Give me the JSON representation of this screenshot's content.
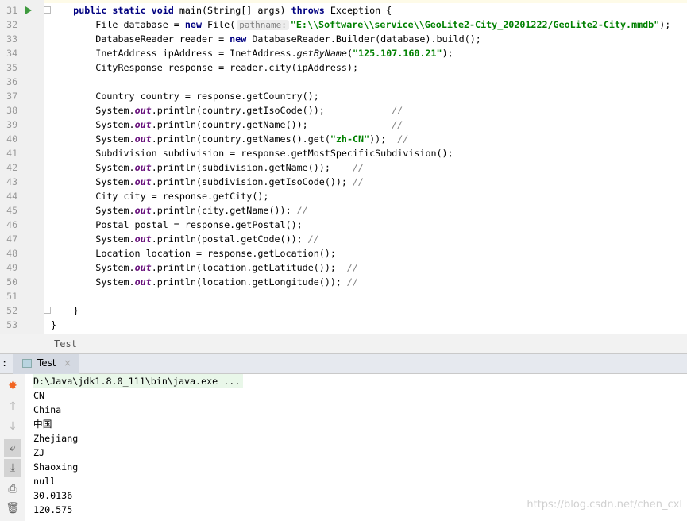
{
  "editor": {
    "lines": [
      {
        "n": "31",
        "seg": [
          [
            "t",
            "    "
          ],
          [
            "k",
            "public static void "
          ],
          [
            "t",
            "main(String[] args) "
          ],
          [
            "k",
            "throws "
          ],
          [
            "t",
            "Exception {"
          ]
        ]
      },
      {
        "n": "32",
        "seg": [
          [
            "t",
            "        File database = "
          ],
          [
            "k",
            "new "
          ],
          [
            "t",
            "File("
          ],
          [
            "h",
            "pathname:"
          ],
          [
            "s",
            "\"E:\\\\Software\\\\service\\\\GeoLite2-City_20201222/GeoLite2-City.mmdb\""
          ],
          [
            "t",
            ");"
          ]
        ]
      },
      {
        "n": "33",
        "seg": [
          [
            "t",
            "        DatabaseReader reader = "
          ],
          [
            "k",
            "new "
          ],
          [
            "t",
            "DatabaseReader.Builder(database).build();"
          ]
        ]
      },
      {
        "n": "34",
        "seg": [
          [
            "t",
            "        InetAddress ipAddress = InetAddress."
          ],
          [
            "i",
            "getByName"
          ],
          [
            "t",
            "("
          ],
          [
            "s",
            "\"125.107.160.21\""
          ],
          [
            "t",
            ");"
          ]
        ]
      },
      {
        "n": "35",
        "seg": [
          [
            "t",
            "        CityResponse response = reader.city(ipAddress);"
          ]
        ]
      },
      {
        "n": "36",
        "seg": []
      },
      {
        "n": "37",
        "seg": [
          [
            "t",
            "        Country country = response.getCountry();"
          ]
        ]
      },
      {
        "n": "38",
        "seg": [
          [
            "t",
            "        System."
          ],
          [
            "o",
            "out"
          ],
          [
            "t",
            ".println(country.getIsoCode());            "
          ],
          [
            "c",
            "//"
          ]
        ]
      },
      {
        "n": "39",
        "seg": [
          [
            "t",
            "        System."
          ],
          [
            "o",
            "out"
          ],
          [
            "t",
            ".println(country.getName());               "
          ],
          [
            "c",
            "//"
          ]
        ]
      },
      {
        "n": "40",
        "seg": [
          [
            "t",
            "        System."
          ],
          [
            "o",
            "out"
          ],
          [
            "t",
            ".println(country.getNames().get("
          ],
          [
            "s",
            "\"zh-CN\""
          ],
          [
            "t",
            "));  "
          ],
          [
            "c",
            "//"
          ]
        ]
      },
      {
        "n": "41",
        "seg": [
          [
            "t",
            "        Subdivision subdivision = response.getMostSpecificSubdivision();"
          ]
        ]
      },
      {
        "n": "42",
        "seg": [
          [
            "t",
            "        System."
          ],
          [
            "o",
            "out"
          ],
          [
            "t",
            ".println(subdivision.getName());    "
          ],
          [
            "c",
            "//"
          ]
        ]
      },
      {
        "n": "43",
        "seg": [
          [
            "t",
            "        System."
          ],
          [
            "o",
            "out"
          ],
          [
            "t",
            ".println(subdivision.getIsoCode()); "
          ],
          [
            "c",
            "//"
          ]
        ]
      },
      {
        "n": "44",
        "seg": [
          [
            "t",
            "        City city = response.getCity();"
          ]
        ]
      },
      {
        "n": "45",
        "seg": [
          [
            "t",
            "        System."
          ],
          [
            "o",
            "out"
          ],
          [
            "t",
            ".println(city.getName()); "
          ],
          [
            "c",
            "//"
          ]
        ]
      },
      {
        "n": "46",
        "seg": [
          [
            "t",
            "        Postal postal = response.getPostal();"
          ]
        ]
      },
      {
        "n": "47",
        "seg": [
          [
            "t",
            "        System."
          ],
          [
            "o",
            "out"
          ],
          [
            "t",
            ".println(postal.getCode()); "
          ],
          [
            "c",
            "//"
          ]
        ]
      },
      {
        "n": "48",
        "seg": [
          [
            "t",
            "        Location location = response.getLocation();"
          ]
        ]
      },
      {
        "n": "49",
        "seg": [
          [
            "t",
            "        System."
          ],
          [
            "o",
            "out"
          ],
          [
            "t",
            ".println(location.getLatitude());  "
          ],
          [
            "c",
            "//"
          ]
        ]
      },
      {
        "n": "50",
        "seg": [
          [
            "t",
            "        System."
          ],
          [
            "o",
            "out"
          ],
          [
            "t",
            ".println(location.getLongitude()); "
          ],
          [
            "c",
            "//"
          ]
        ]
      },
      {
        "n": "51",
        "seg": []
      },
      {
        "n": "52",
        "seg": [
          [
            "t",
            "    }"
          ]
        ]
      },
      {
        "n": "53",
        "seg": [
          [
            "t",
            "}"
          ]
        ]
      }
    ]
  },
  "breadcrumb": "Test",
  "run_panel": {
    "prefix": ":",
    "tab_label": "Test",
    "tab_close": "×",
    "output": [
      "D:\\Java\\jdk1.8.0_111\\bin\\java.exe ...",
      "CN",
      "China",
      "中国",
      "Zhejiang",
      "ZJ",
      "Shaoxing",
      "null",
      "30.0136",
      "120.575"
    ]
  },
  "watermark": "https://blog.csdn.net/chen_cxl"
}
